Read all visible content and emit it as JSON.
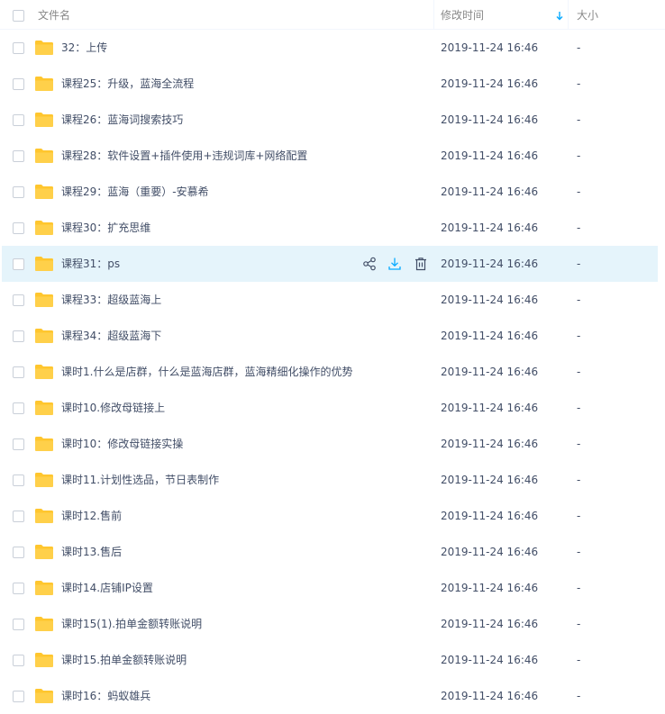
{
  "header": {
    "name_label": "文件名",
    "time_label": "修改时间",
    "size_label": "大小"
  },
  "colors": {
    "folder": "#ffc62e",
    "hover": "#e5f4fb",
    "accent": "#09aaff"
  },
  "rows": [
    {
      "name": "32：上传",
      "time": "2019-11-24 16:46",
      "size": "-"
    },
    {
      "name": "课程25：升级，蓝海全流程",
      "time": "2019-11-24 16:46",
      "size": "-"
    },
    {
      "name": "课程26：蓝海词搜索技巧",
      "time": "2019-11-24 16:46",
      "size": "-"
    },
    {
      "name": "课程28：软件设置+插件使用+违规词库+网络配置",
      "time": "2019-11-24 16:46",
      "size": "-"
    },
    {
      "name": "课程29：蓝海（重要）-安慕希",
      "time": "2019-11-24 16:46",
      "size": "-"
    },
    {
      "name": "课程30：扩充思维",
      "time": "2019-11-24 16:46",
      "size": "-"
    },
    {
      "name": "课程31：ps",
      "time": "2019-11-24 16:46",
      "size": "-"
    },
    {
      "name": "课程33：超级蓝海上",
      "time": "2019-11-24 16:46",
      "size": "-"
    },
    {
      "name": "课程34：超级蓝海下",
      "time": "2019-11-24 16:46",
      "size": "-"
    },
    {
      "name": "课时1.什么是店群，什么是蓝海店群，蓝海精细化操作的优势",
      "time": "2019-11-24 16:46",
      "size": "-"
    },
    {
      "name": "课时10.修改母链接上",
      "time": "2019-11-24 16:46",
      "size": "-"
    },
    {
      "name": "课时10：修改母链接实操",
      "time": "2019-11-24 16:46",
      "size": "-"
    },
    {
      "name": "课时11.计划性选品，节日表制作",
      "time": "2019-11-24 16:46",
      "size": "-"
    },
    {
      "name": "课时12.售前",
      "time": "2019-11-24 16:46",
      "size": "-"
    },
    {
      "name": "课时13.售后",
      "time": "2019-11-24 16:46",
      "size": "-"
    },
    {
      "name": "课时14.店铺IP设置",
      "time": "2019-11-24 16:46",
      "size": "-"
    },
    {
      "name": "课时15(1).拍单金额转账说明",
      "time": "2019-11-24 16:46",
      "size": "-"
    },
    {
      "name": "课时15.拍单金额转账说明",
      "time": "2019-11-24 16:46",
      "size": "-"
    },
    {
      "name": "课时16：蚂蚁雄兵",
      "time": "2019-11-24 16:46",
      "size": "-"
    }
  ]
}
